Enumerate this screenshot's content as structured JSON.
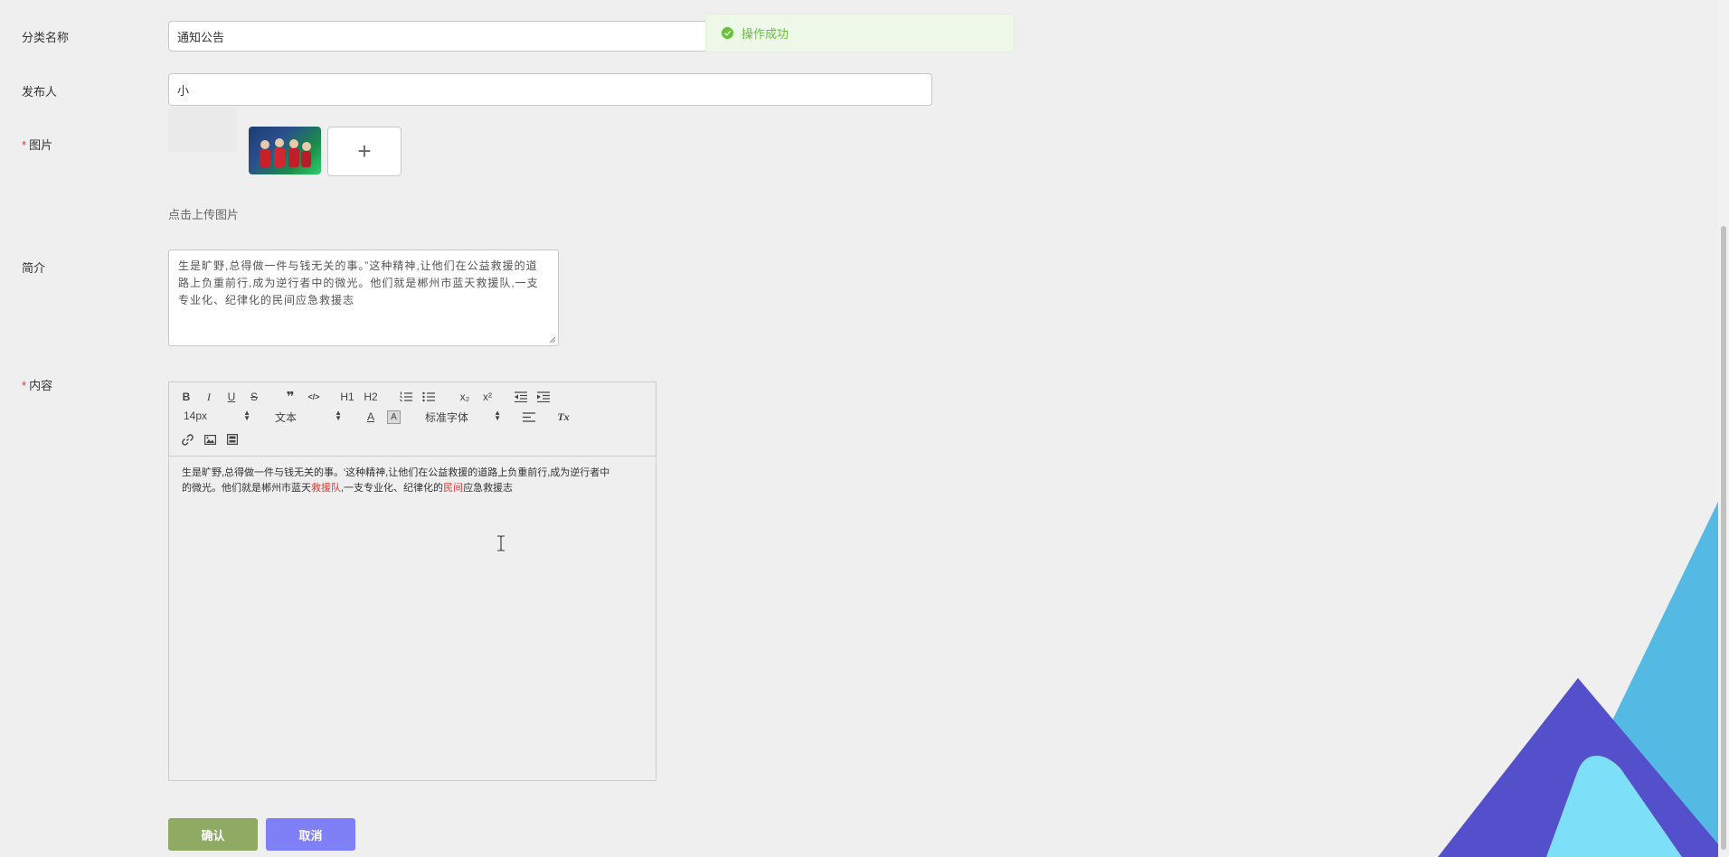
{
  "form": {
    "category": {
      "label": "分类名称",
      "value": "通知公告"
    },
    "publisher": {
      "label": "发布人",
      "value": "小"
    },
    "image": {
      "label": "图片",
      "upload_hint": "点击上传图片",
      "add_glyph": "+"
    },
    "summary": {
      "label": "简介",
      "value": "生是旷野,总得做一件与钱无关的事。”这种精神,让他们在公益救援的道路上负重前行,成为逆行者中的微光。他们就是郴州市蓝天救援队,一支专业化、纪律化的民间应急救援志"
    },
    "content": {
      "label": "内容"
    },
    "required_mark": "*"
  },
  "toast": {
    "text": "操作成功",
    "color": "#67c23a"
  },
  "editor": {
    "toolbar": {
      "bold": "B",
      "italic": "I",
      "underline": "U",
      "strike": "S",
      "blockquote": "❞",
      "code": "</>",
      "h1": "H1",
      "h2": "H2",
      "subscript": "x₂",
      "superscript": "x²",
      "size": "14px",
      "header": "文本",
      "font": "标准字体",
      "font_color": "A",
      "background": "A",
      "clean": "Tx"
    },
    "content": {
      "line1": "生是旷野,总得做一件与钱无关的事。'这种精神,让他们在公益救援的道路上负重前行,成为逆行者中",
      "line2_a": "的微光。他们就是郴州市蓝天",
      "line2_b": "救援队",
      "line2_c": ",一支专业化、纪律化的",
      "line2_d": "民间",
      "line2_e": "应急救援志"
    }
  },
  "buttons": {
    "confirm": "确认",
    "cancel": "取消"
  },
  "colors": {
    "confirm": "#8faa62",
    "cancel": "#7f80f6",
    "required": "#e53935",
    "highlight": "#e53935",
    "deco_light_blue": "#54b9e3",
    "deco_purple": "#5450cc",
    "deco_cyan": "#7ee0f8"
  }
}
